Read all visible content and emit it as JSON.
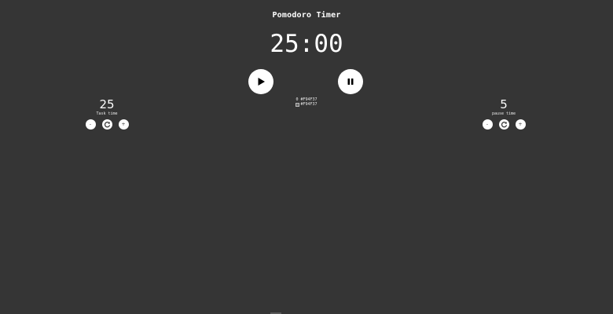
{
  "header": {
    "title": "Pomodoro Timer"
  },
  "timer": {
    "display": "25:00"
  },
  "controls": {
    "play_icon": "play-icon",
    "pause_icon": "pause-icon"
  },
  "center": {
    "text": "0 #F94F37",
    "broken_image_alt": "#F94F37"
  },
  "task": {
    "value": "25",
    "label": "Task time",
    "decrement_label": "-",
    "increment_label": "+",
    "reset_icon": "refresh-icon"
  },
  "pause": {
    "value": "5",
    "label": "pause time",
    "decrement_label": "-",
    "increment_label": "+",
    "reset_icon": "refresh-icon"
  },
  "colors": {
    "background": "#353535",
    "text": "#ffffff",
    "button": "#ffffff",
    "accent": "#F94F37"
  }
}
